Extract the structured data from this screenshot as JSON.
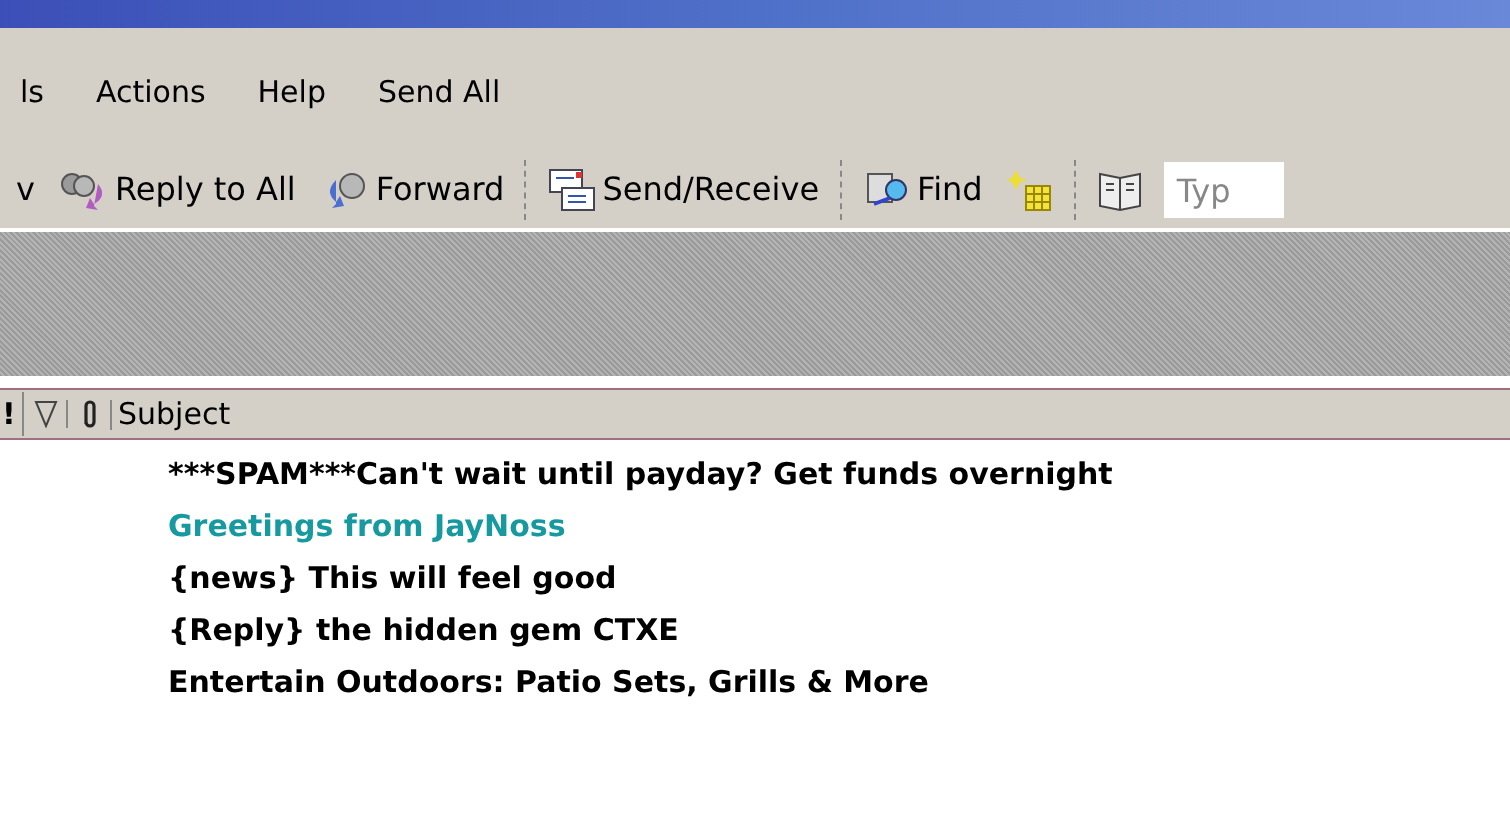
{
  "menu": [
    {
      "label": "ls"
    },
    {
      "label": "Actions"
    },
    {
      "label": "Help"
    },
    {
      "label": "Send All"
    }
  ],
  "toolbar": [
    {
      "kind": "text",
      "label": "v"
    },
    {
      "kind": "button",
      "label": "Reply to All"
    },
    {
      "kind": "button",
      "label": "Forward"
    },
    {
      "kind": "separator"
    },
    {
      "kind": "button",
      "label": "Send/Receive"
    },
    {
      "kind": "separator"
    },
    {
      "kind": "button",
      "label": "Find"
    },
    {
      "kind": "icon-button"
    },
    {
      "kind": "separator"
    },
    {
      "kind": "icon-button"
    },
    {
      "kind": "field",
      "placeholder": "Typ"
    }
  ],
  "columns": [
    {
      "kind": "importance",
      "label": "!"
    },
    {
      "kind": "flag"
    },
    {
      "kind": "attachment"
    },
    {
      "kind": "subject",
      "label": "Subject"
    }
  ],
  "messages": [
    {
      "subject": "***SPAM***Can't wait until payday? Get funds overnight",
      "color": "#000000"
    },
    {
      "subject": "Greetings from JayNoss",
      "color": "#169aa0"
    },
    {
      "subject": "{news} This will feel good",
      "color": "#000000"
    },
    {
      "subject": "{Reply} the hidden gem CTXE",
      "color": "#000000"
    },
    {
      "subject": "Entertain Outdoors: Patio Sets, Grills & More",
      "color": "#000000"
    }
  ]
}
